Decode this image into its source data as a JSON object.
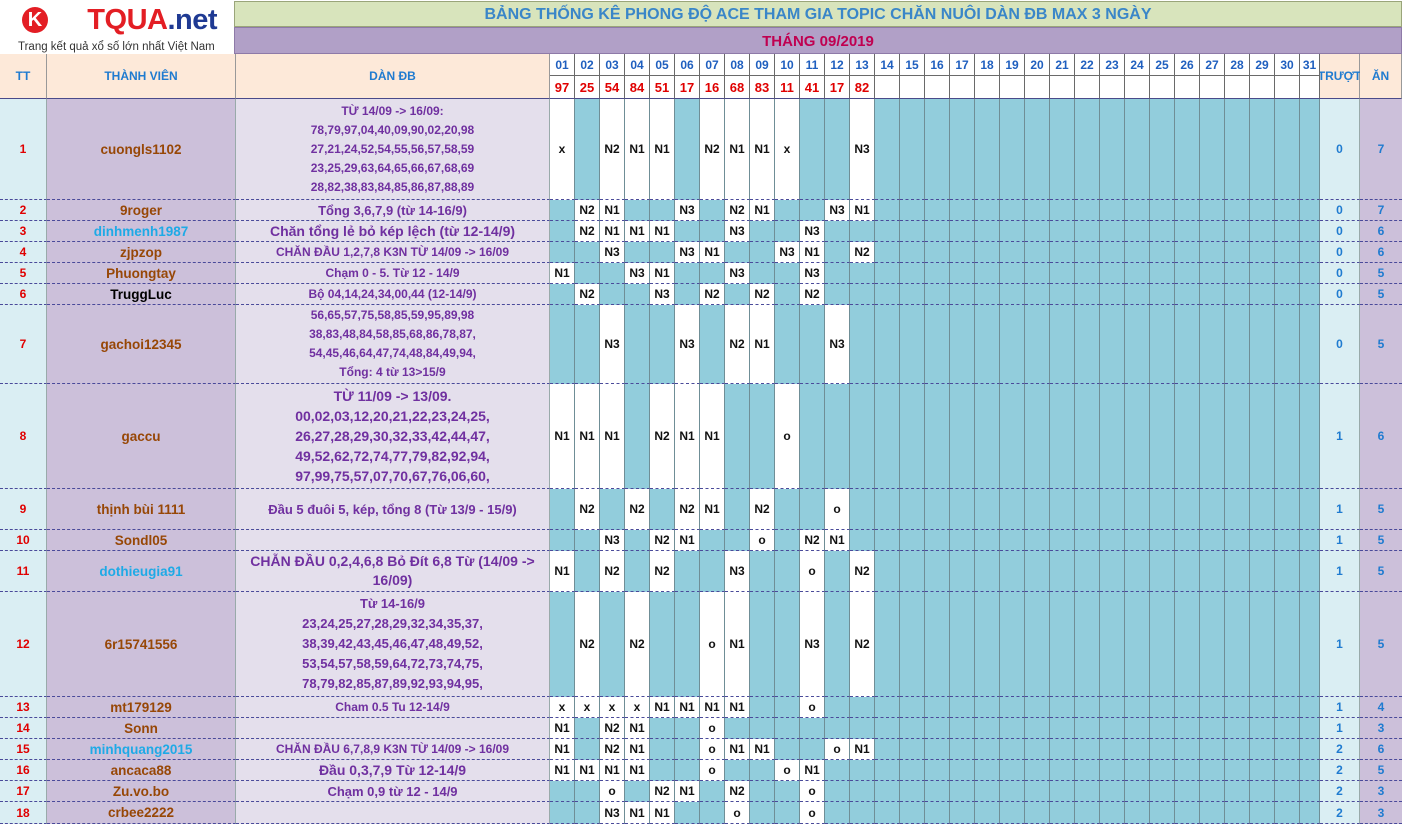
{
  "logo": {
    "text_left": "KE",
    "text_mid": "TQUA",
    "text_right": ".net",
    "tagline": "Trang kết quả xổ số lớn nhất Việt Nam"
  },
  "title": "BẢNG THỐNG KÊ PHONG ĐỘ ACE THAM GIA TOPIC CHĂN NUÔI DÀN ĐB MAX 3 NGÀY",
  "month": "THÁNG 09/2019",
  "headers": {
    "tt": "TT",
    "member": "THÀNH VIÊN",
    "dan": "DÀN ĐB",
    "miss": "TRƯỢT",
    "win": "ĂN"
  },
  "days": [
    "01",
    "02",
    "03",
    "04",
    "05",
    "06",
    "07",
    "08",
    "09",
    "10",
    "11",
    "12",
    "13",
    "14",
    "15",
    "16",
    "17",
    "18",
    "19",
    "20",
    "21",
    "22",
    "23",
    "24",
    "25",
    "26",
    "27",
    "28",
    "29",
    "30",
    "31"
  ],
  "results": [
    "97",
    "25",
    "54",
    "84",
    "51",
    "17",
    "16",
    "68",
    "83",
    "11",
    "41",
    "17",
    "82",
    "",
    "",
    "",
    "",
    "",
    "",
    "",
    "",
    "",
    "",
    "",
    "",
    "",
    "",
    "",
    "",
    "",
    ""
  ],
  "colors": {
    "member_brown": "#974706",
    "member_blue": "#1eaae6",
    "day_cell_teal": "#92cddc",
    "title_green": "#d8e4bc",
    "month_purple": "#b1a0c7"
  },
  "rows": [
    {
      "tt": "1",
      "member": "cuongls1102",
      "color": "brown",
      "dan": [
        "TỪ 14/09 -> 16/09:",
        "78,79,97,04,40,09,90,02,20,98",
        "27,21,24,52,54,55,56,57,58,59",
        "23,25,29,63,64,65,66,67,68,69",
        "28,82,38,83,84,85,86,87,88,89"
      ],
      "marks": [
        "x",
        "",
        "N2",
        "N1",
        "N1",
        "",
        "N2",
        "N1",
        "N1",
        "x",
        "",
        "",
        "N3"
      ],
      "miss": "0",
      "win": "7"
    },
    {
      "tt": "2",
      "member": "9roger",
      "color": "brown",
      "dan": [
        "Tổng 3,6,7,9 (từ 14-16/9)"
      ],
      "marks": [
        "",
        "N2",
        "N1",
        "",
        "",
        "N3",
        "",
        "N2",
        "N1",
        "",
        "",
        "N3",
        "N1"
      ],
      "miss": "0",
      "win": "7"
    },
    {
      "tt": "3",
      "member": "dinhmenh1987",
      "color": "blue",
      "dan": [
        "Chăn tổng lẻ bỏ kép lệch (từ 12-14/9)"
      ],
      "marks": [
        "",
        "N2",
        "N1",
        "N1",
        "N1",
        "",
        "",
        "N3",
        "",
        "",
        "N3",
        "",
        ""
      ],
      "miss": "0",
      "win": "6"
    },
    {
      "tt": "4",
      "member": "zjpzop",
      "color": "brown",
      "dan": [
        "CHĂN ĐẦU 1,2,7,8 K3N TỪ 14/09 -> 16/09"
      ],
      "marks": [
        "",
        "",
        "N3",
        "",
        "",
        "N3",
        "N1",
        "",
        "",
        "N3",
        "N1",
        "",
        "N2"
      ],
      "miss": "0",
      "win": "6"
    },
    {
      "tt": "5",
      "member": "Phuongtay",
      "color": "brown",
      "dan": [
        "Chạm 0 - 5. Từ 12 - 14/9"
      ],
      "marks": [
        "N1",
        "",
        "",
        "N3",
        "N1",
        "",
        "",
        "N3",
        "",
        "",
        "N3",
        "",
        ""
      ],
      "miss": "0",
      "win": "5"
    },
    {
      "tt": "6",
      "member": "TruggLuc",
      "color": "black",
      "dan": [
        "Bộ 04,14,24,34,00,44 (12-14/9)"
      ],
      "marks": [
        "",
        "N2",
        "",
        "",
        "N3",
        "",
        "N2",
        "",
        "N2",
        "",
        "N2",
        "",
        ""
      ],
      "miss": "0",
      "win": "5"
    },
    {
      "tt": "7",
      "member": "gachoi12345",
      "color": "brown",
      "dan": [
        "56,65,57,75,58,85,59,95,89,98",
        "38,83,48,84,58,85,68,86,78,87,",
        "54,45,46,64,47,74,48,84,49,94,",
        "Tổng: 4 từ 13>15/9"
      ],
      "marks": [
        "",
        "",
        "N3",
        "",
        "",
        "N3",
        "",
        "N2",
        "N1",
        "",
        "",
        "N3",
        ""
      ],
      "miss": "0",
      "win": "5"
    },
    {
      "tt": "8",
      "member": "gaccu",
      "color": "brown",
      "dan": [
        "TỪ 11/09 -> 13/09.",
        "00,02,03,12,20,21,22,23,24,25,",
        "26,27,28,29,30,32,33,42,44,47,",
        "49,52,62,72,74,77,79,82,92,94,",
        "97,99,75,57,07,70,67,76,06,60,"
      ],
      "marks": [
        "N1",
        "N1",
        "N1",
        "",
        "N2",
        "N1",
        "N1",
        "",
        "",
        "o",
        "",
        "",
        ""
      ],
      "miss": "1",
      "win": "6"
    },
    {
      "tt": "9",
      "member": "thịnh bùi 1111",
      "color": "brown",
      "dan": [
        "Đầu 5 đuôi 5, kép, tổng 8 (Từ 13/9 - 15/9)"
      ],
      "marks": [
        "",
        "N2",
        "",
        "N2",
        "",
        "N2",
        "N1",
        "",
        "N2",
        "",
        "",
        "o",
        ""
      ],
      "miss": "1",
      "win": "5"
    },
    {
      "tt": "10",
      "member": "Sondl05",
      "color": "brown",
      "dan": [
        ""
      ],
      "marks": [
        "",
        "",
        "N3",
        "",
        "N2",
        "N1",
        "",
        "",
        "o",
        "",
        "N2",
        "N1",
        ""
      ],
      "miss": "1",
      "win": "5"
    },
    {
      "tt": "11",
      "member": "dothieugia91",
      "color": "blue",
      "dan": [
        "CHẴN ĐẦU 0,2,4,6,8 Bỏ Đít 6,8 Từ (14/09 ->",
        "16/09)"
      ],
      "marks": [
        "N1",
        "",
        "N2",
        "",
        "N2",
        "",
        "",
        "N3",
        "",
        "",
        "o",
        "",
        "N2"
      ],
      "miss": "1",
      "win": "5"
    },
    {
      "tt": "12",
      "member": "6r15741556",
      "color": "brown",
      "dan": [
        "Từ 14-16/9",
        "23,24,25,27,28,29,32,34,35,37,",
        "38,39,42,43,45,46,47,48,49,52,",
        "53,54,57,58,59,64,72,73,74,75,",
        "78,79,82,85,87,89,92,93,94,95,"
      ],
      "marks": [
        "",
        "N2",
        "",
        "N2",
        "",
        "",
        "o",
        "N1",
        "",
        "",
        "N3",
        "",
        "N2"
      ],
      "miss": "1",
      "win": "5"
    },
    {
      "tt": "13",
      "member": "mt179129",
      "color": "brown",
      "dan": [
        "Cham 0.5 Tu 12-14/9"
      ],
      "marks": [
        "x",
        "x",
        "x",
        "x",
        "N1",
        "N1",
        "N1",
        "N1",
        "",
        "",
        "o",
        "",
        ""
      ],
      "miss": "1",
      "win": "4"
    },
    {
      "tt": "14",
      "member": "Sonn",
      "color": "brown",
      "dan": [
        ""
      ],
      "marks": [
        "N1",
        "",
        "N2",
        "N1",
        "",
        "",
        "o",
        "",
        "",
        "",
        "",
        "",
        ""
      ],
      "miss": "1",
      "win": "3"
    },
    {
      "tt": "15",
      "member": "minhquang2015",
      "color": "blue",
      "dan": [
        "CHĂN ĐẦU 6,7,8,9 K3N TỪ 14/09 -> 16/09"
      ],
      "marks": [
        "N1",
        "",
        "N2",
        "N1",
        "",
        "",
        "o",
        "N1",
        "N1",
        "",
        "",
        "o",
        "N1"
      ],
      "miss": "2",
      "win": "6"
    },
    {
      "tt": "16",
      "member": "ancaca88",
      "color": "brown",
      "dan": [
        "Đầu 0,3,7,9 Từ 12-14/9"
      ],
      "marks": [
        "N1",
        "N1",
        "N1",
        "N1",
        "",
        "",
        "o",
        "",
        "",
        "o",
        "N1",
        "",
        ""
      ],
      "miss": "2",
      "win": "5"
    },
    {
      "tt": "17",
      "member": "Zu.vo.bo",
      "color": "brown",
      "dan": [
        "Chạm 0,9 từ 12 - 14/9"
      ],
      "marks": [
        "",
        "",
        "o",
        "",
        "N2",
        "N1",
        "",
        "N2",
        "",
        "",
        "o",
        "",
        ""
      ],
      "miss": "2",
      "win": "3"
    },
    {
      "tt": "18",
      "member": "crbee2222",
      "color": "brown",
      "dan": [
        ""
      ],
      "marks": [
        "",
        "",
        "N3",
        "N1",
        "N1",
        "",
        "",
        "o",
        "",
        "",
        "o",
        "",
        ""
      ],
      "miss": "2",
      "win": "3"
    }
  ]
}
